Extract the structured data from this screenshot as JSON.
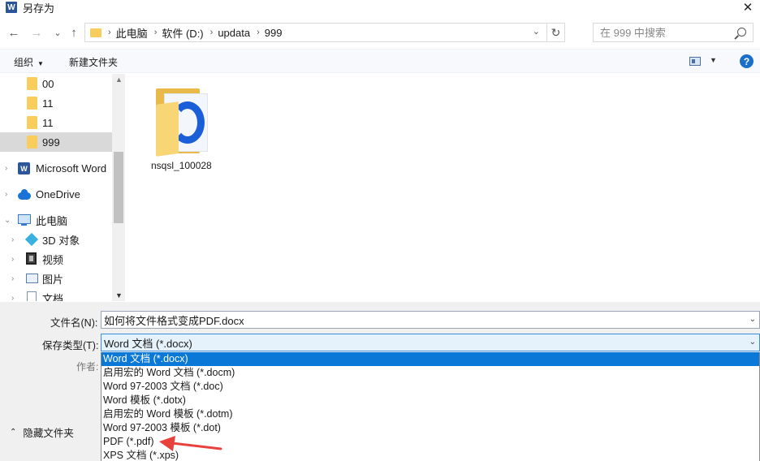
{
  "window": {
    "title": "另存为",
    "app_icon_letter": "W",
    "close_glyph": "✕"
  },
  "nav": {
    "back_glyph": "←",
    "forward_glyph": "→",
    "recent_glyph": "⌄",
    "up_glyph": "↑"
  },
  "address": {
    "crumbs": [
      "此电脑",
      "软件 (D:)",
      "updata",
      "999"
    ],
    "separator": "›",
    "dropdown_glyph": "⌄",
    "refresh_glyph": "↻"
  },
  "search": {
    "placeholder": "在 999 中搜索"
  },
  "toolbar": {
    "organize_label": "组织",
    "organize_caret": "▼",
    "new_folder_label": "新建文件夹",
    "view_caret": "▼",
    "help_label": "?"
  },
  "sidebar": {
    "items": [
      {
        "label": "00",
        "icon": "folder-icon"
      },
      {
        "label": "11",
        "icon": "folder-icon"
      },
      {
        "label": "11",
        "icon": "folder-icon"
      },
      {
        "label": "999",
        "icon": "folder-icon",
        "selected": true
      },
      {
        "label": "Microsoft Word",
        "icon": "word-icon"
      },
      {
        "label": "OneDrive",
        "icon": "onedrive-icon"
      },
      {
        "label": "此电脑",
        "icon": "computer-icon"
      },
      {
        "label": "3D 对象",
        "icon": "3d-objects-icon"
      },
      {
        "label": "视频",
        "icon": "video-icon"
      },
      {
        "label": "图片",
        "icon": "pictures-icon"
      },
      {
        "label": "文档",
        "icon": "documents-icon"
      }
    ],
    "collapsed_chevron": "›",
    "expanded_chevron": "⌄",
    "scroll_up": "▲",
    "scroll_down": "▼"
  },
  "content": {
    "items": [
      {
        "name": "nsqsl_100028",
        "type": "folder"
      }
    ]
  },
  "form": {
    "filename_label": "文件名(N):",
    "filename_value": "如何将文件格式变成PDF.docx",
    "filetype_label": "保存类型(T):",
    "filetype_value": "Word 文档 (*.docx)",
    "author_label": "作者:",
    "dropdown_glyph": "⌄",
    "hide_folders_label": "隐藏文件夹",
    "hide_folders_glyph": "⌃"
  },
  "filetype_options": [
    "Word 文档 (*.docx)",
    "启用宏的 Word 文档 (*.docm)",
    "Word 97-2003 文档 (*.doc)",
    "Word 模板 (*.dotx)",
    "启用宏的 Word 模板 (*.dotm)",
    "Word 97-2003 模板 (*.dot)",
    "PDF (*.pdf)",
    "XPS 文档 (*.xps)"
  ],
  "selected_filetype_index": 0,
  "colors": {
    "selection_blue": "#0a78d7",
    "annotation_arrow": "#e8413c",
    "folder_yellow": "#f8cd5c"
  }
}
